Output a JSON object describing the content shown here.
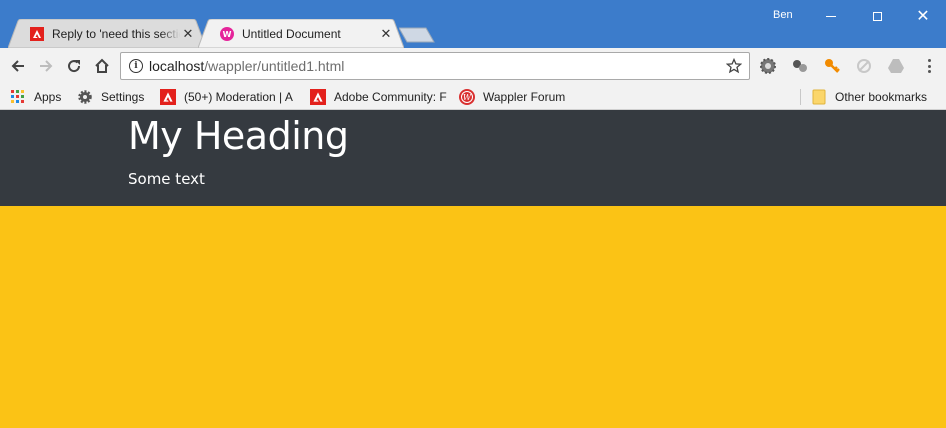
{
  "window": {
    "profile_name": "Ben",
    "min_icon": "minimize-icon",
    "max_icon": "maximize-icon",
    "close_glyph": "✕"
  },
  "tabs": [
    {
      "title": "Reply to 'need this section",
      "favicon": "adobe-icon",
      "active": false,
      "close_glyph": "✕"
    },
    {
      "title": "Untitled Document",
      "favicon": "wappler-icon",
      "active": true,
      "close_glyph": "✕"
    }
  ],
  "toolbar": {
    "url_host": "localhost",
    "url_path": "/wappler/untitled1.html"
  },
  "bookmarks": [
    {
      "label": "Apps",
      "icon": "apps-grid-icon"
    },
    {
      "label": "Settings",
      "icon": "gear-icon"
    },
    {
      "label": "(50+) Moderation | A",
      "icon": "adobe-icon"
    },
    {
      "label": "Adobe Community: F",
      "icon": "adobe-icon"
    },
    {
      "label": "Wappler Forum",
      "icon": "wappler-forum-icon"
    },
    {
      "label": "Other bookmarks",
      "icon": "folder-icon"
    }
  ],
  "page": {
    "heading": "My Heading",
    "text": "Some text"
  },
  "colors": {
    "titlebar": "#3c7ccb",
    "hero_bg": "#353a40",
    "page_bg": "#fbc315",
    "adobe_red": "#e3211c",
    "wappler_pink": "#e5249a"
  }
}
